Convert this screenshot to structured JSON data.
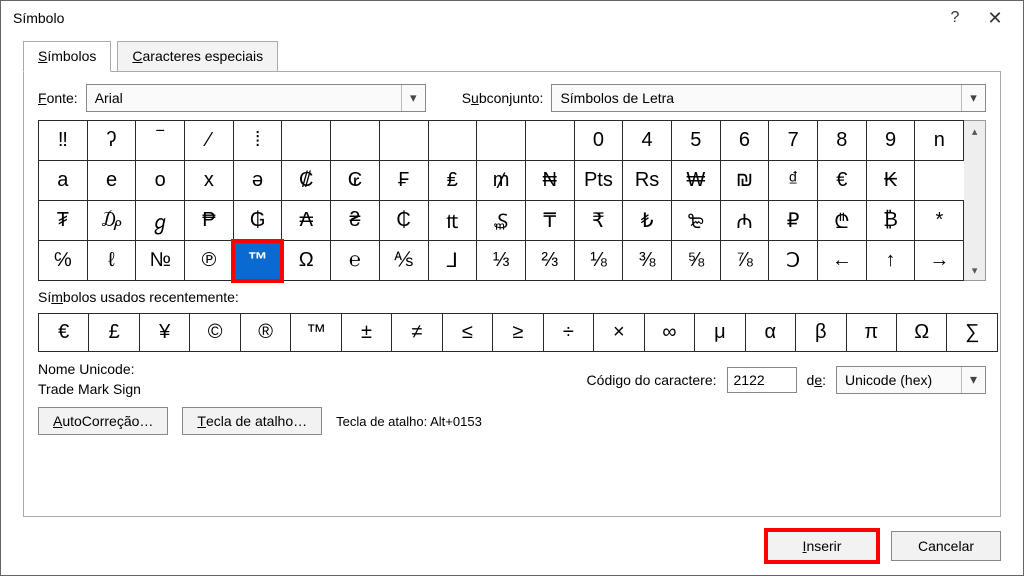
{
  "title": "Símbolo",
  "tabs": {
    "symbols": "Símbolos",
    "special": "Caracteres especiais"
  },
  "labels": {
    "font": "Fonte:",
    "subset": "Subconjunto:",
    "recent": "Símbolos usados recentemente:",
    "unicode_name": "Nome Unicode:",
    "char_code": "Código do caractere:",
    "from": "de:",
    "shortcut_prefix": "Tecla de atalho:"
  },
  "font": {
    "value": "Arial"
  },
  "subset": {
    "value": "Símbolos de Letra"
  },
  "grid": {
    "rows": [
      [
        "‼",
        "ʔ",
        "‾",
        "⁄",
        "⁞",
        "",
        "",
        "",
        "",
        "",
        "",
        "0",
        "4",
        "5",
        "6",
        "7",
        "8",
        "9",
        "n"
      ],
      [
        "a",
        "e",
        "o",
        "x",
        "ə",
        "₡",
        "₢",
        "₣",
        "₤",
        "₥",
        "₦",
        "Pts",
        "Rs",
        "₩",
        "₪",
        "₫",
        "€",
        "₭"
      ],
      [
        "₮",
        "₯",
        "ℊ",
        "₱",
        "₲",
        "₳",
        "₴",
        "₵",
        "₶",
        "₷",
        "₸",
        "₹",
        "₺",
        "₻",
        "₼",
        "₽",
        "₾",
        "₿",
        "*"
      ],
      [
        "℅",
        "ℓ",
        "№",
        "℗",
        "™",
        "Ω",
        "℮",
        "⅍",
        "⅃",
        "⅓",
        "⅔",
        "⅛",
        "⅜",
        "⅝",
        "⅞",
        "Ↄ",
        "←",
        "↑",
        "→"
      ]
    ],
    "selected": {
      "row": 3,
      "col": 4
    }
  },
  "recent": [
    "€",
    "£",
    "¥",
    "©",
    "®",
    "™",
    "±",
    "≠",
    "≤",
    "≥",
    "÷",
    "×",
    "∞",
    "μ",
    "α",
    "β",
    "π",
    "Ω",
    "∑"
  ],
  "unicode_name": "Trade Mark Sign",
  "char_code": "2122",
  "from_value": "Unicode (hex)",
  "shortcut_value": "Alt+0153",
  "buttons": {
    "autocorrect": "AutoCorreção…",
    "shortcut": "Tecla de atalho…",
    "insert": "Inserir",
    "cancel": "Cancelar",
    "help": "?",
    "close": "✕"
  }
}
